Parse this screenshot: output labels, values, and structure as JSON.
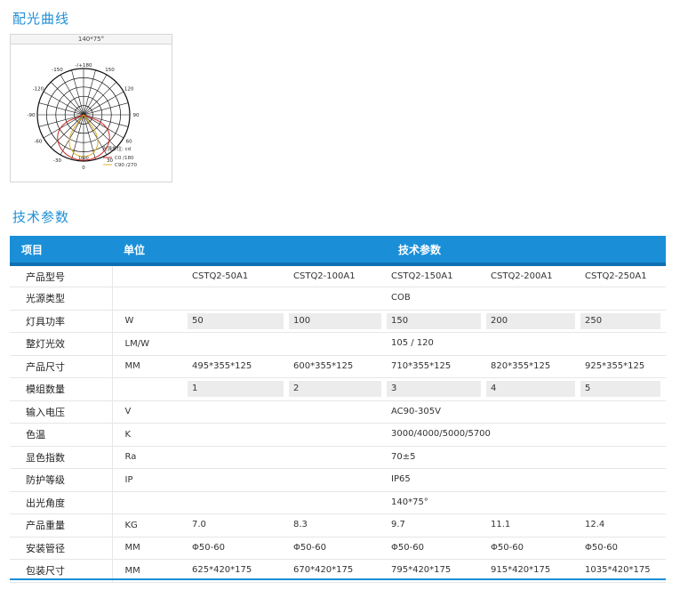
{
  "sections": {
    "light_curve_title": "配光曲线",
    "tech_title": "技术参数"
  },
  "polar": {
    "header": "140*75°",
    "top_label": "-/+180",
    "labels": {
      "n150": "-150",
      "p150": "150",
      "n120": "-120",
      "p120": "120",
      "n90": "-90",
      "p90": "90",
      "n60": "-60",
      "p60": "60",
      "n30": "-30",
      "p30": "30",
      "zero": "0",
      "ring_bottom": "1600"
    },
    "legend_title": "光强单位: cd",
    "legend": [
      {
        "name": "C0  /180",
        "color": "#cc2222"
      },
      {
        "name": "C90 /270",
        "color": "#e0b020"
      }
    ]
  },
  "table": {
    "headers": {
      "item": "项目",
      "unit": "单位",
      "params": "技术参数"
    },
    "rows": [
      {
        "item": "产品型号",
        "unit": "",
        "values": [
          "CSTQ2-50A1",
          "CSTQ2-100A1",
          "CSTQ2-150A1",
          "CSTQ2-200A1",
          "CSTQ2-250A1"
        ]
      },
      {
        "item": "光源类型",
        "unit": "",
        "span": "COB"
      },
      {
        "item": "灯具功率",
        "unit": "W",
        "values": [
          "50",
          "100",
          "150",
          "200",
          "250"
        ]
      },
      {
        "item": "整灯光效",
        "unit": "LM/W",
        "span": "105 / 120"
      },
      {
        "item": "产品尺寸",
        "unit": "MM",
        "values": [
          "495*355*125",
          "600*355*125",
          "710*355*125",
          "820*355*125",
          "925*355*125"
        ]
      },
      {
        "item": "模组数量",
        "unit": "",
        "values": [
          "1",
          "2",
          "3",
          "4",
          "5"
        ]
      },
      {
        "item": "输入电压",
        "unit": "V",
        "span": "AC90-305V"
      },
      {
        "item": "色温",
        "unit": "K",
        "span": "3000/4000/5000/5700"
      },
      {
        "item": "显色指数",
        "unit": "Ra",
        "span": "70±5"
      },
      {
        "item": "防护等级",
        "unit": "IP",
        "span": "IP65"
      },
      {
        "item": "出光角度",
        "unit": "",
        "span": "140*75°"
      },
      {
        "item": "产品重量",
        "unit": "KG",
        "values": [
          "7.0",
          "8.3",
          "9.7",
          "11.1",
          "12.4"
        ]
      },
      {
        "item": "安装管径",
        "unit": "MM",
        "values": [
          "Φ50-60",
          "Φ50-60",
          "Φ50-60",
          "Φ50-60",
          "Φ50-60"
        ]
      },
      {
        "item": "包装尺寸",
        "unit": "MM",
        "values": [
          "625*420*175",
          "670*420*175",
          "795*420*175",
          "915*420*175",
          "1035*420*175"
        ]
      }
    ]
  }
}
